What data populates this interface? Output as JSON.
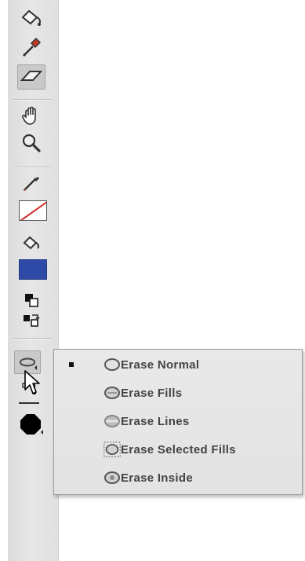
{
  "toolbar": {
    "tools": [
      {
        "icon": "paint-bucket-icon"
      },
      {
        "icon": "eyedropper-icon"
      },
      {
        "icon": "eraser-icon",
        "active": true
      },
      {
        "icon": "hand-icon"
      },
      {
        "icon": "zoom-icon"
      },
      {
        "icon": "stroke-color-icon"
      },
      {
        "icon": "fill-color-icon"
      },
      {
        "icon": "black-and-white-icon"
      },
      {
        "icon": "swap-colors-icon"
      },
      {
        "icon": "eraser-mode-icon"
      },
      {
        "icon": "faucet-icon"
      },
      {
        "icon": "eraser-shape-icon"
      }
    ],
    "fill_color": "#2f4aa6",
    "stroke_color": "none"
  },
  "eraser_menu": {
    "selected": "Erase Normal",
    "items": [
      {
        "label": "Erase Normal",
        "icon": "erase-normal-icon",
        "checked": true
      },
      {
        "label": "Erase Fills",
        "icon": "erase-fills-icon",
        "checked": false
      },
      {
        "label": "Erase Lines",
        "icon": "erase-lines-icon",
        "checked": false
      },
      {
        "label": "Erase Selected Fills",
        "icon": "erase-selected-fills-icon",
        "checked": false
      },
      {
        "label": "Erase Inside",
        "icon": "erase-inside-icon",
        "checked": false
      }
    ]
  }
}
